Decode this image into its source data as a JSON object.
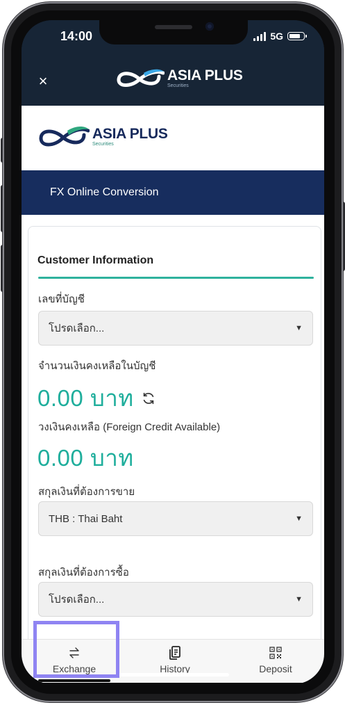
{
  "status_bar": {
    "time": "14:00",
    "network": "5G"
  },
  "header": {
    "close_label": "×",
    "logo_text": "ASIA PLUS",
    "logo_sub": "Securities"
  },
  "brand": {
    "logo_text": "ASIA PLUS",
    "logo_sub": "Securities"
  },
  "banner": {
    "title": "FX Online Conversion"
  },
  "form": {
    "section_title": "Customer Information",
    "account_label": "เลขที่บัญชี",
    "account_value": "โปรดเลือก...",
    "balance_label": "จำนวนเงินคงเหลือในบัญชี",
    "balance_value": "0.00 บาท",
    "credit_label": "วงเงินคงเหลือ (Foreign Credit Available)",
    "credit_value": "0.00 บาท",
    "sell_label": "สกุลเงินที่ต้องการขาย",
    "sell_value": "THB : Thai Baht",
    "buy_label": "สกุลเงินที่ต้องการซื้อ",
    "buy_value": "โปรดเลือก..."
  },
  "nav": {
    "items": [
      {
        "label": "Exchange",
        "icon": "exchange-icon"
      },
      {
        "label": "History",
        "icon": "history-icon"
      },
      {
        "label": "Deposit",
        "icon": "qr-code-icon"
      }
    ],
    "active": "Exchange"
  },
  "colors": {
    "header_bg": "#172536",
    "banner_bg": "#172d5e",
    "accent_teal": "#1fae9c",
    "highlight": "#8f84f2"
  }
}
